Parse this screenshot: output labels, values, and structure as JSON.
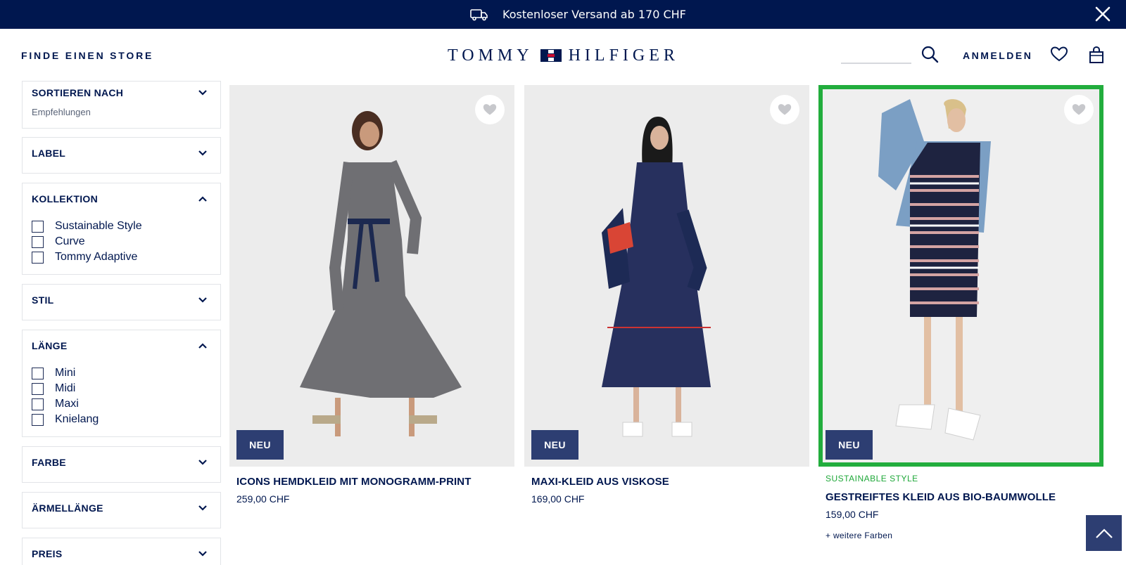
{
  "promo": {
    "text": "Kostenloser Versand ab 170 CHF",
    "icon": "truck-icon"
  },
  "header": {
    "store_link": "FINDE EINEN STORE",
    "logo_left": "TOMMY",
    "logo_right": "HILFIGER",
    "login_link": "ANMELDEN",
    "search_placeholder": ""
  },
  "filters": {
    "sort": {
      "title": "SORTIEREN NACH",
      "value": "Empfehlungen"
    },
    "label": {
      "title": "LABEL"
    },
    "collection": {
      "title": "KOLLEKTION",
      "options": [
        "Sustainable Style",
        "Curve",
        "Tommy Adaptive"
      ]
    },
    "style": {
      "title": "STIL"
    },
    "length": {
      "title": "LÄNGE",
      "options": [
        "Mini",
        "Midi",
        "Maxi",
        "Knielang"
      ]
    },
    "color": {
      "title": "FARBE"
    },
    "sleeve": {
      "title": "ÄRMELLÄNGE"
    },
    "price": {
      "title": "PREIS"
    }
  },
  "products": [
    {
      "badge": "NEU",
      "name": "ICONS HEMDKLEID MIT MONOGRAMM-PRINT",
      "price": "259,00 CHF"
    },
    {
      "badge": "NEU",
      "name": "MAXI-KLEID AUS VISKOSE",
      "price": "169,00 CHF"
    },
    {
      "badge": "NEU",
      "tag": "SUSTAINABLE STYLE",
      "name": "GESTREIFTES KLEID AUS BIO-BAUMWOLLE",
      "price": "159,00 CHF",
      "more": "+ weitere Farben"
    }
  ],
  "colors": {
    "navy": "#00174f",
    "badge": "#2d3e72",
    "highlight": "#22ad3d",
    "flag_red": "#cc0c2f"
  }
}
